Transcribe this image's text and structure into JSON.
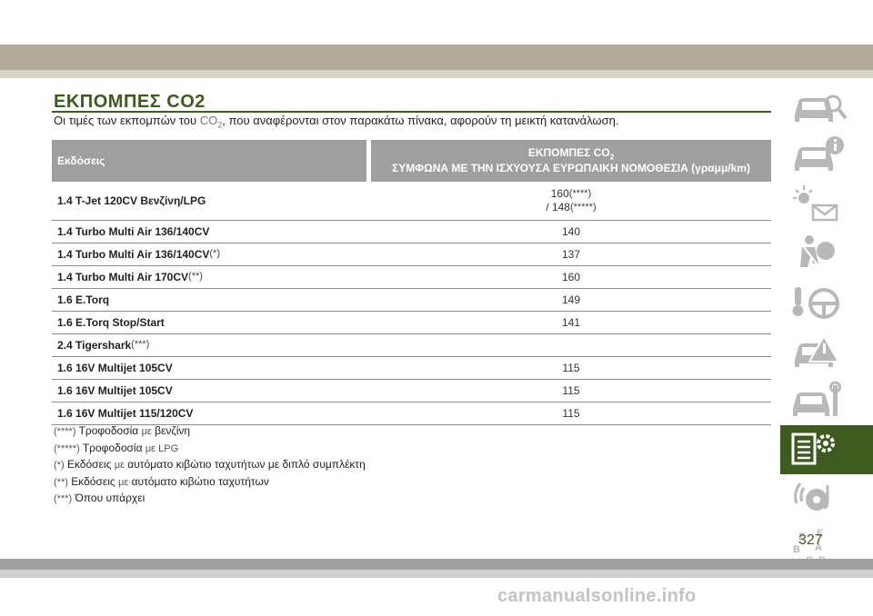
{
  "section": {
    "title": "ΕΚΠΟΜΠΕΣ CO2",
    "intro_a": "Οι τιμές των εκπομπών του ",
    "intro_co": "CO",
    "intro_sub": "2",
    "intro_b": ", που αναφέρονται στον παρακάτω πίνακα, αφορούν τη μεικτή κατανάλωση."
  },
  "table": {
    "col1": "Εκδόσεις",
    "col2_a": "ΕΚΠΟΜΠΕΣ CO",
    "col2_sub": "2",
    "col2_b": "ΣΥΜΦΩΝΑ ΜΕ ΤΗΝ ΙΣΧΥΟΥΣΑ ΕΥΡΩΠΑΙΚΗ ΝΟΜΟΘΕΣΙΑ (γραμμ/km)",
    "rows": [
      {
        "model": "1.4 T-Jet 120CV Βενζίνη/LPG",
        "note": "",
        "value": "160",
        "value_note": "(****)",
        "value2": "/ 148",
        "value2_note": "(*****)"
      },
      {
        "model": "1.4 Turbo Multi Air 136/140CV",
        "note": "",
        "value": "140"
      },
      {
        "model": "1.4 Turbo Multi Air 136/140CV",
        "note": "(*)",
        "value": "137"
      },
      {
        "model": "1.4 Turbo Multi Air 170CV",
        "note": "(**)",
        "value": "160"
      },
      {
        "model": "1.6 E.Torq",
        "note": "",
        "value": "149"
      },
      {
        "model": "1.6 E.Torq Stop/Start",
        "note": "",
        "value": "141"
      },
      {
        "model": "2.4 Tigershark",
        "note": "(***)",
        "value": ""
      },
      {
        "model": "1.6 16V Multijet 105CV",
        "note": "",
        "value": "115"
      },
      {
        "model": "1.6 16V Multijet 105CV",
        "note": "",
        "value": "115"
      },
      {
        "model": "1.6 16V Multijet 115/120CV",
        "note": "",
        "value": "115"
      }
    ]
  },
  "notes": [
    {
      "mark": "(****)",
      "a": " Τροφοδοσία ",
      "b": "με",
      "c": " βενζίνη"
    },
    {
      "mark": "(*****)",
      "a": " Τροφοδοσία ",
      "b": "με LPG",
      "c": ""
    },
    {
      "mark": "(*)",
      "a": " Εκδόσεις ",
      "b": "με",
      "c": " αυτόματο κιβώτιο ταχυτήτων με διπλό συμπλέκτη"
    },
    {
      "mark": "(**)",
      "a": " Εκδόσεις ",
      "b": "με",
      "c": " αυτόματο κιβώτιο ταχυτήτων"
    },
    {
      "mark": "(***)",
      "a": " Όπου υπάρχει",
      "b": "",
      "c": ""
    }
  ],
  "sidebar": {
    "icons": [
      "car-search-icon",
      "car-info-icon",
      "dashboard-lights-icon",
      "seatbelt-airbag-icon",
      "steering-key-icon",
      "car-warning-icon",
      "car-tools-icon",
      "specs-gear-icon",
      "media-phone-icon",
      "alphabet-index-icon"
    ],
    "active_index": 7
  },
  "page_number": "327",
  "watermark": "carmanualsonline.info",
  "colors": {
    "accent": "#3d5b1f",
    "header_bg": "#9f9f9f",
    "top_band": "#b3ac9c"
  }
}
